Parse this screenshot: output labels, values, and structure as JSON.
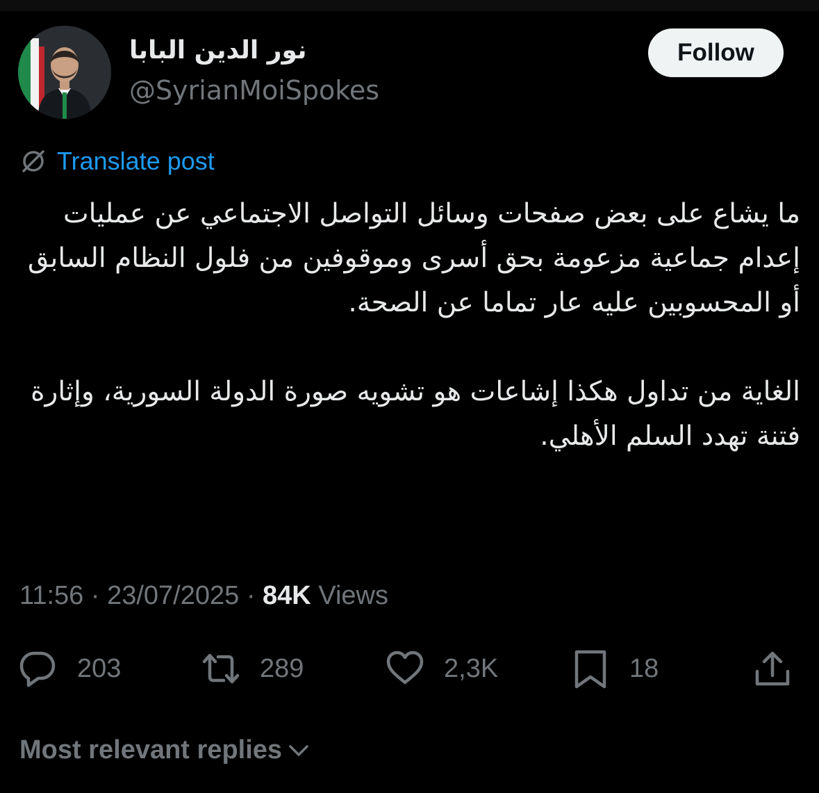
{
  "colors": {
    "background": "#000000",
    "text_primary": "#e7e9ea",
    "text_secondary": "#71767b",
    "link": "#1d9bf0",
    "follow_button_bg": "#eff3f4"
  },
  "author": {
    "display_name": "نور الدين البابا",
    "handle": "@SyrianMoiSpokes",
    "follow_label": "Follow"
  },
  "translate": {
    "icon": "translate-globe-icon",
    "label": "Translate post"
  },
  "post": {
    "paragraph_1": "ما يشاع على بعض صفحات وسائل التواصل الاجتماعي عن عمليات إعدام جماعية مزعومة بحق أسرى وموقوفين من فلول النظام السابق أو المحسوبين عليه عار تماما عن الصحة.",
    "paragraph_2": "الغاية من تداول هكذا إشاعات هو تشويه صورة الدولة السورية، وإثارة فتنة تهدد السلم الأهلي."
  },
  "meta": {
    "time": "11:56",
    "date": "23/07/2025",
    "separator": "·",
    "views_count": "84K",
    "views_label": "Views"
  },
  "actions": {
    "replies": {
      "icon": "reply-bubble-icon",
      "count": "203"
    },
    "reposts": {
      "icon": "repost-icon",
      "count": "289"
    },
    "likes": {
      "icon": "heart-icon",
      "count": "2,3K"
    },
    "bookmarks": {
      "icon": "bookmark-icon",
      "count": "18"
    },
    "share": {
      "icon": "share-icon"
    }
  },
  "replies_sort": {
    "label": "Most relevant replies",
    "icon": "chevron-down-icon"
  }
}
